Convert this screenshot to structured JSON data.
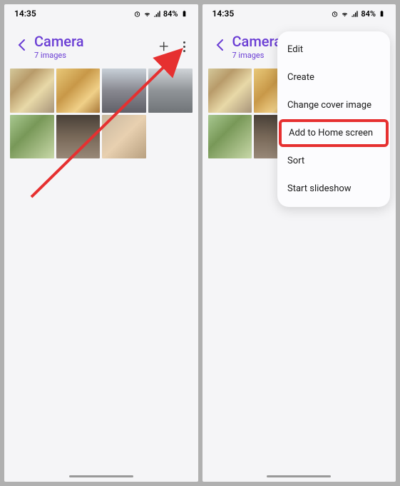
{
  "status": {
    "time": "14:35",
    "battery_pct": "84%"
  },
  "header": {
    "title": "Camera",
    "subtitle": "7 images"
  },
  "dropdown": {
    "items": [
      {
        "label": "Edit"
      },
      {
        "label": "Create"
      },
      {
        "label": "Change cover image"
      },
      {
        "label": "Add to Home screen",
        "highlighted": true
      },
      {
        "label": "Sort"
      },
      {
        "label": "Start slideshow"
      }
    ]
  },
  "thumbnail_count": 7
}
